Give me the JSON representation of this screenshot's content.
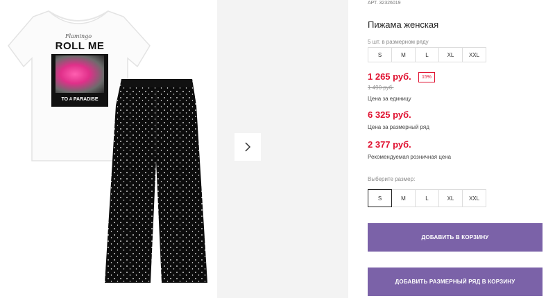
{
  "product": {
    "article": "АРТ. 32326019",
    "title": "Пижама женская",
    "pack_note": "5 шт. в размерном ряду"
  },
  "image": {
    "tee_script": "Flamingo",
    "tee_headline": "ROLL ME",
    "tee_footer": "TO # PARADISE"
  },
  "pack_sizes": [
    "S",
    "M",
    "L",
    "XL",
    "XXL"
  ],
  "prices": {
    "unit_price": "1 265 руб.",
    "discount": "15%",
    "old_price": "1 490 руб.",
    "unit_caption": "Цена за единицу",
    "pack_price": "6 325 руб.",
    "pack_caption": "Цена за размерный ряд",
    "retail_price": "2 377 руб.",
    "retail_caption": "Рекомендуемая розничная цена"
  },
  "size_select": {
    "label": "Выберите размер:",
    "options": [
      "S",
      "M",
      "L",
      "XL",
      "XXL"
    ],
    "selected": "S"
  },
  "buttons": {
    "add_to_cart": "ДОБАВИТЬ В КОРЗИНУ",
    "add_pack_to_cart": "ДОБАВИТЬ РАЗМЕРНЫЙ РЯД В КОРЗИНУ"
  },
  "colors": {
    "accent": "#7b62a8",
    "price": "#e0102f"
  }
}
